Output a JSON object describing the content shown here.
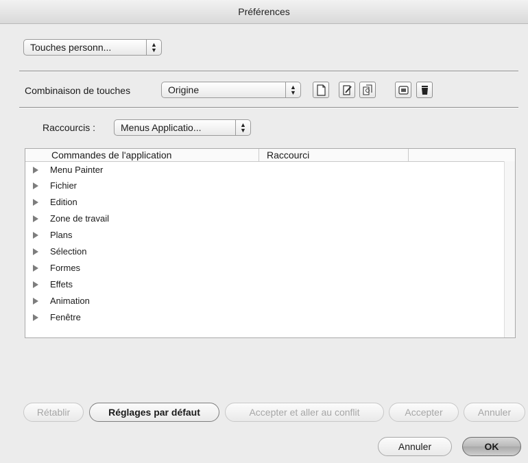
{
  "window": {
    "title": "Préférences"
  },
  "category_popup": {
    "value": "Touches personn..."
  },
  "keyset": {
    "label": "Combinaison de touches",
    "popup_value": "Origine",
    "icons": [
      "new-document-icon",
      "edit-set-icon",
      "duplicate-set-icon",
      "export-icon",
      "trash-icon"
    ]
  },
  "shortcuts": {
    "label": "Raccourcis :",
    "popup_value": "Menus Applicatio..."
  },
  "table": {
    "headers": [
      "Commandes de l'application",
      "Raccourci"
    ],
    "rows": [
      "Menu Painter",
      "Fichier",
      "Edition",
      "Zone de travail",
      "Plans",
      "Sélection",
      "Formes",
      "Effets",
      "Animation",
      "Fenêtre"
    ]
  },
  "action_buttons": {
    "retablir": "Rétablir",
    "defaults": "Réglages par défaut",
    "accept_conflict": "Accepter et aller au conflit",
    "accepter": "Accepter",
    "annuler": "Annuler"
  },
  "dialog_buttons": {
    "cancel": "Annuler",
    "ok": "OK"
  }
}
